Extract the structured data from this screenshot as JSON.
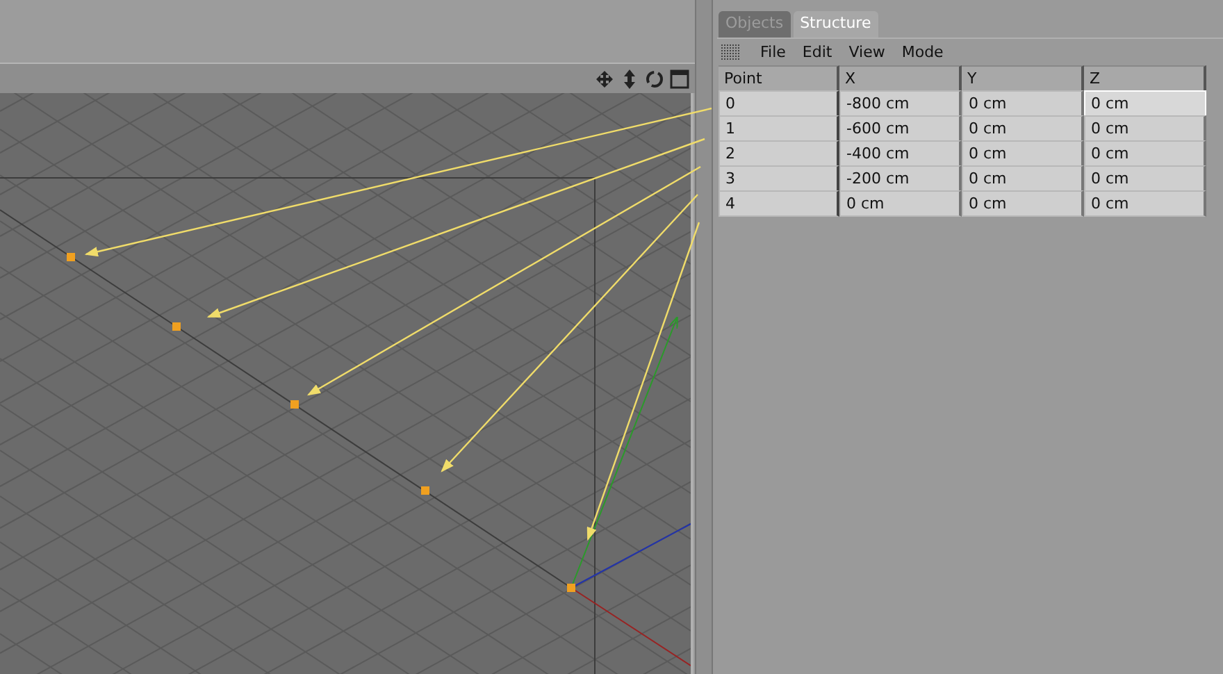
{
  "tabs": [
    {
      "label": "Objects",
      "selected": false
    },
    {
      "label": "Structure",
      "selected": true
    }
  ],
  "menu": [
    "File",
    "Edit",
    "View",
    "Mode"
  ],
  "table": {
    "columns": [
      "Point",
      "X",
      "Y",
      "Z"
    ],
    "rows": [
      {
        "cells": [
          "0",
          "-800 cm",
          "0 cm",
          "0 cm"
        ],
        "selected": true
      },
      {
        "cells": [
          "1",
          "-600 cm",
          "0 cm",
          "0 cm"
        ],
        "selected": false
      },
      {
        "cells": [
          "2",
          "-400 cm",
          "0 cm",
          "0 cm"
        ],
        "selected": false
      },
      {
        "cells": [
          "3",
          "-200 cm",
          "0 cm",
          "0 cm"
        ],
        "selected": false
      },
      {
        "cells": [
          "4",
          "0 cm",
          "0 cm",
          "0 cm"
        ],
        "selected": false
      }
    ]
  }
}
